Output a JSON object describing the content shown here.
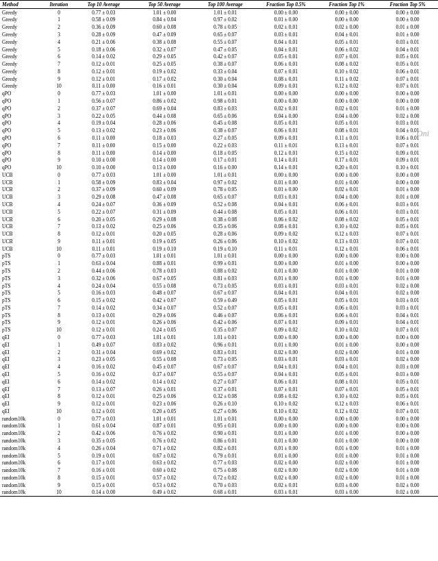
{
  "headers": [
    "Method",
    "Iteration",
    "Top 10 Average",
    "Top 50 Average",
    "Top 100 Average",
    "Fraction Top 0.5%",
    "Fraction Top 1%",
    "Fraction Top 5%"
  ],
  "rows": [
    [
      "Greedy",
      "0",
      "0.77 ± 0.03",
      "1.01 ± 0.00",
      "1.01 ± 0.01",
      "0.00 ± 0.00",
      "0.00 ± 0.00",
      "0.00 ± 0.00"
    ],
    [
      "Greedy",
      "1",
      "0.58 ± 0.09",
      "0.84 ± 0.04",
      "0.97 ± 0.02",
      "0.01 ± 0.00",
      "0.00 ± 0.00",
      "0.00 ± 0.00"
    ],
    [
      "Greedy",
      "2",
      "0.36 ± 0.09",
      "0.60 ± 0.08",
      "0.78 ± 0.05",
      "0.02 ± 0.01",
      "0.02 ± 0.00",
      "0.01 ± 0.00"
    ],
    [
      "Greedy",
      "3",
      "0.28 ± 0.09",
      "0.47 ± 0.09",
      "0.65 ± 0.07",
      "0.03 ± 0.01",
      "0.04 ± 0.01",
      "0.01 ± 0.00"
    ],
    [
      "Greedy",
      "4",
      "0.21 ± 0.06",
      "0.38 ± 0.08",
      "0.55 ± 0.07",
      "0.04 ± 0.01",
      "0.05 ± 0.01",
      "0.03 ± 0.01"
    ],
    [
      "Greedy",
      "5",
      "0.18 ± 0.06",
      "0.32 ± 0.07",
      "0.47 ± 0.05",
      "0.04 ± 0.01",
      "0.06 ± 0.02",
      "0.04 ± 0.01"
    ],
    [
      "Greedy",
      "6",
      "0.14 ± 0.02",
      "0.29 ± 0.05",
      "0.42 ± 0.07",
      "0.05 ± 0.01",
      "0.07 ± 0.01",
      "0.05 ± 0.01"
    ],
    [
      "Greedy",
      "7",
      "0.12 ± 0.01",
      "0.25 ± 0.05",
      "0.38 ± 0.07",
      "0.06 ± 0.01",
      "0.08 ± 0.02",
      "0.05 ± 0.01"
    ],
    [
      "Greedy",
      "8",
      "0.12 ± 0.01",
      "0.19 ± 0.02",
      "0.33 ± 0.04",
      "0.07 ± 0.01",
      "0.10 ± 0.02",
      "0.06 ± 0.01"
    ],
    [
      "Greedy",
      "9",
      "0.12 ± 0.01",
      "0.17 ± 0.02",
      "0.30 ± 0.04",
      "0.08 ± 0.01",
      "0.11 ± 0.02",
      "0.07 ± 0.01"
    ],
    [
      "Greedy",
      "10",
      "0.11 ± 0.00",
      "0.16 ± 0.01",
      "0.30 ± 0.04",
      "0.09 ± 0.01",
      "0.12 ± 0.02",
      "0.07 ± 0.01"
    ],
    [
      "qPO",
      "0",
      "0.77 ± 0.03",
      "1.01 ± 0.00",
      "1.01 ± 0.01",
      "0.00 ± 0.00",
      "0.00 ± 0.00",
      "0.00 ± 0.00"
    ],
    [
      "qPO",
      "1",
      "0.56 ± 0.07",
      "0.86 ± 0.02",
      "0.98 ± 0.01",
      "0.00 ± 0.00",
      "0.00 ± 0.00",
      "0.00 ± 0.00"
    ],
    [
      "qPO",
      "2",
      "0.37 ± 0.07",
      "0.69 ± 0.04",
      "0.83 ± 0.03",
      "0.02 ± 0.01",
      "0.02 ± 0.01",
      "0.01 ± 0.00"
    ],
    [
      "qPO",
      "3",
      "0.22 ± 0.05",
      "0.44 ± 0.08",
      "0.65 ± 0.06",
      "0.04 ± 0.00",
      "0.04 ± 0.00",
      "0.02 ± 0.00"
    ],
    [
      "qPO",
      "4",
      "0.19 ± 0.04",
      "0.28 ± 0.06",
      "0.45 ± 0.08",
      "0.05 ± 0.01",
      "0.05 ± 0.01",
      "0.03 ± 0.01"
    ],
    [
      "qPO",
      "5",
      "0.13 ± 0.02",
      "0.23 ± 0.06",
      "0.38 ± 0.07",
      "0.06 ± 0.01",
      "0.08 ± 0.01",
      "0.04 ± 0.01"
    ],
    [
      "qPO",
      "6",
      "0.11 ± 0.00",
      "0.18 ± 0.03",
      "0.27 ± 0.05",
      "0.09 ± 0.01",
      "0.11 ± 0.01",
      "0.06 ± 0.01"
    ],
    [
      "qPO",
      "7",
      "0.11 ± 0.00",
      "0.15 ± 0.00",
      "0.22 ± 0.03",
      "0.11 ± 0.01",
      "0.13 ± 0.01",
      "0.07 ± 0.01"
    ],
    [
      "qPO",
      "8",
      "0.11 ± 0.00",
      "0.14 ± 0.00",
      "0.18 ± 0.05",
      "0.12 ± 0.01",
      "0.15 ± 0.02",
      "0.09 ± 0.01"
    ],
    [
      "qPO",
      "9",
      "0.10 ± 0.00",
      "0.14 ± 0.00",
      "0.17 ± 0.01",
      "0.14 ± 0.01",
      "0.17 ± 0.01",
      "0.09 ± 0.01"
    ],
    [
      "qPO",
      "10",
      "0.10 ± 0.00",
      "0.13 ± 0.00",
      "0.16 ± 0.00",
      "0.14 ± 0.01",
      "0.20 ± 0.01",
      "0.10 ± 0.01"
    ],
    [
      "UCB",
      "0",
      "0.77 ± 0.03",
      "1.01 ± 0.00",
      "1.01 ± 0.01",
      "0.00 ± 0.00",
      "0.00 ± 0.00",
      "0.00 ± 0.00"
    ],
    [
      "UCB",
      "1",
      "0.58 ± 0.09",
      "0.83 ± 0.04",
      "0.97 ± 0.02",
      "0.01 ± 0.00",
      "0.01 ± 0.00",
      "0.00 ± 0.00"
    ],
    [
      "UCB",
      "2",
      "0.37 ± 0.09",
      "0.60 ± 0.09",
      "0.78 ± 0.05",
      "0.01 ± 0.00",
      "0.02 ± 0.01",
      "0.01 ± 0.00"
    ],
    [
      "UCB",
      "3",
      "0.29 ± 0.08",
      "0.47 ± 0.08",
      "0.65 ± 0.07",
      "0.03 ± 0.01",
      "0.04 ± 0.00",
      "0.01 ± 0.00"
    ],
    [
      "UCB",
      "4",
      "0.24 ± 0.07",
      "0.36 ± 0.09",
      "0.52 ± 0.08",
      "0.04 ± 0.01",
      "0.06 ± 0.01",
      "0.03 ± 0.01"
    ],
    [
      "UCB",
      "5",
      "0.22 ± 0.07",
      "0.31 ± 0.09",
      "0.44 ± 0.08",
      "0.05 ± 0.01",
      "0.06 ± 0.01",
      "0.03 ± 0.01"
    ],
    [
      "UCB",
      "6",
      "0.20 ± 0.05",
      "0.29 ± 0.08",
      "0.38 ± 0.08",
      "0.06 ± 0.02",
      "0.08 ± 0.02",
      "0.05 ± 0.01"
    ],
    [
      "UCB",
      "7",
      "0.13 ± 0.02",
      "0.25 ± 0.06",
      "0.35 ± 0.06",
      "0.08 ± 0.01",
      "0.10 ± 0.02",
      "0.05 ± 0.01"
    ],
    [
      "UCB",
      "8",
      "0.12 ± 0.01",
      "0.20 ± 0.05",
      "0.28 ± 0.06",
      "0.09 ± 0.02",
      "0.12 ± 0.03",
      "0.07 ± 0.01"
    ],
    [
      "UCB",
      "9",
      "0.11 ± 0.01",
      "0.19 ± 0.05",
      "0.26 ± 0.06",
      "0.10 ± 0.02",
      "0.13 ± 0.03",
      "0.07 ± 0.01"
    ],
    [
      "UCB",
      "10",
      "0.11 ± 0.01",
      "0.19 ± 0.10",
      "0.19 ± 0.10",
      "0.11 ± 0.01",
      "0.12 ± 0.01",
      "0.06 ± 0.01"
    ],
    [
      "pTS",
      "0",
      "0.77 ± 0.03",
      "1.01 ± 0.01",
      "1.01 ± 0.01",
      "0.00 ± 0.00",
      "0.00 ± 0.00",
      "0.00 ± 0.00"
    ],
    [
      "pTS",
      "1",
      "0.63 ± 0.04",
      "0.88 ± 0.01",
      "0.99 ± 0.01",
      "0.00 ± 0.00",
      "0.01 ± 0.00",
      "0.00 ± 0.00"
    ],
    [
      "pTS",
      "2",
      "0.44 ± 0.06",
      "0.78 ± 0.03",
      "0.88 ± 0.02",
      "0.01 ± 0.00",
      "0.01 ± 0.00",
      "0.01 ± 0.00"
    ],
    [
      "pTS",
      "3",
      "0.32 ± 0.06",
      "0.67 ± 0.05",
      "0.81 ± 0.03",
      "0.01 ± 0.00",
      "0.01 ± 0.00",
      "0.01 ± 0.00"
    ],
    [
      "pTS",
      "4",
      "0.24 ± 0.04",
      "0.55 ± 0.08",
      "0.73 ± 0.05",
      "0.03 ± 0.01",
      "0.03 ± 0.01",
      "0.02 ± 0.00"
    ],
    [
      "pTS",
      "5",
      "0.16 ± 0.03",
      "0.48 ± 0.07",
      "0.67 ± 0.07",
      "0.04 ± 0.01",
      "0.04 ± 0.01",
      "0.02 ± 0.00"
    ],
    [
      "pTS",
      "6",
      "0.15 ± 0.02",
      "0.42 ± 0.07",
      "0.59 ± 0.49",
      "0.05 ± 0.01",
      "0.05 ± 0.01",
      "0.03 ± 0.01"
    ],
    [
      "pTS",
      "7",
      "0.14 ± 0.02",
      "0.34 ± 0.07",
      "0.52 ± 0.07",
      "0.05 ± 0.01",
      "0.06 ± 0.01",
      "0.03 ± 0.01"
    ],
    [
      "pTS",
      "8",
      "0.13 ± 0.01",
      "0.29 ± 0.06",
      "0.46 ± 0.07",
      "0.06 ± 0.01",
      "0.06 ± 0.01",
      "0.04 ± 0.01"
    ],
    [
      "pTS",
      "9",
      "0.12 ± 0.01",
      "0.26 ± 0.06",
      "0.42 ± 0.06",
      "0.07 ± 0.01",
      "0.09 ± 0.01",
      "0.04 ± 0.01"
    ],
    [
      "pTS",
      "10",
      "0.12 ± 0.01",
      "0.24 ± 0.05",
      "0.35 ± 0.07",
      "0.09 ± 0.02",
      "0.10 ± 0.02",
      "0.07 ± 0.01"
    ],
    [
      "qEI",
      "0",
      "0.77 ± 0.03",
      "1.01 ± 0.01",
      "1.01 ± 0.01",
      "0.00 ± 0.00",
      "0.00 ± 0.00",
      "0.00 ± 0.00"
    ],
    [
      "qEI",
      "1",
      "0.49 ± 0.07",
      "0.83 ± 0.02",
      "0.96 ± 0.01",
      "0.01 ± 0.00",
      "0.01 ± 0.00",
      "0.00 ± 0.00"
    ],
    [
      "qEI",
      "2",
      "0.31 ± 0.04",
      "0.69 ± 0.02",
      "0.83 ± 0.01",
      "0.02 ± 0.00",
      "0.02 ± 0.00",
      "0.01 ± 0.00"
    ],
    [
      "qEI",
      "3",
      "0.23 ± 0.05",
      "0.55 ± 0.08",
      "0.73 ± 0.05",
      "0.03 ± 0.01",
      "0.03 ± 0.01",
      "0.02 ± 0.00"
    ],
    [
      "qEI",
      "4",
      "0.16 ± 0.02",
      "0.45 ± 0.07",
      "0.67 ± 0.07",
      "0.04 ± 0.01",
      "0.04 ± 0.01",
      "0.03 ± 0.00"
    ],
    [
      "qEI",
      "5",
      "0.16 ± 0.02",
      "0.37 ± 0.07",
      "0.55 ± 0.07",
      "0.04 ± 0.01",
      "0.05 ± 0.01",
      "0.03 ± 0.00"
    ],
    [
      "qEI",
      "6",
      "0.14 ± 0.02",
      "0.14 ± 0.02",
      "0.27 ± 0.07",
      "0.06 ± 0.01",
      "0.08 ± 0.01",
      "0.05 ± 0.01"
    ],
    [
      "qEI",
      "7",
      "0.13 ± 0.07",
      "0.26 ± 0.01",
      "0.37 ± 0.01",
      "0.07 ± 0.01",
      "0.07 ± 0.01",
      "0.05 ± 0.01"
    ],
    [
      "qEI",
      "8",
      "0.12 ± 0.01",
      "0.25 ± 0.06",
      "0.32 ± 0.08",
      "0.08 ± 0.02",
      "0.10 ± 0.02",
      "0.05 ± 0.01"
    ],
    [
      "qEI",
      "9",
      "0.12 ± 0.01",
      "0.23 ± 0.06",
      "0.26 ± 0.10",
      "0.10 ± 0.02",
      "0.12 ± 0.03",
      "0.06 ± 0.01"
    ],
    [
      "qEI",
      "10",
      "0.12 ± 0.01",
      "0.20 ± 0.05",
      "0.27 ± 0.06",
      "0.10 ± 0.02",
      "0.12 ± 0.02",
      "0.07 ± 0.01"
    ],
    [
      "random10k",
      "0",
      "0.77 ± 0.03",
      "1.01 ± 0.01",
      "1.01 ± 0.01",
      "0.00 ± 0.00",
      "0.00 ± 0.00",
      "0.00 ± 0.00"
    ],
    [
      "random10k",
      "1",
      "0.61 ± 0.04",
      "0.87 ± 0.01",
      "0.95 ± 0.01",
      "0.00 ± 0.00",
      "0.00 ± 0.00",
      "0.00 ± 0.00"
    ],
    [
      "random10k",
      "2",
      "0.42 ± 0.06",
      "0.76 ± 0.02",
      "0.90 ± 0.01",
      "0.01 ± 0.00",
      "0.01 ± 0.00",
      "0.00 ± 0.00"
    ],
    [
      "random10k",
      "3",
      "0.35 ± 0.05",
      "0.76 ± 0.02",
      "0.86 ± 0.01",
      "0.01 ± 0.00",
      "0.01 ± 0.00",
      "0.00 ± 0.00"
    ],
    [
      "random10k",
      "4",
      "0.26 ± 0.04",
      "0.71 ± 0.02",
      "0.82 ± 0.01",
      "0.01 ± 0.00",
      "0.01 ± 0.00",
      "0.01 ± 0.00"
    ],
    [
      "random10k",
      "5",
      "0.19 ± 0.01",
      "0.67 ± 0.02",
      "0.79 ± 0.01",
      "0.01 ± 0.00",
      "0.01 ± 0.00",
      "0.01 ± 0.00"
    ],
    [
      "random10k",
      "6",
      "0.17 ± 0.01",
      "0.63 ± 0.02",
      "0.77 ± 0.03",
      "0.02 ± 0.00",
      "0.02 ± 0.00",
      "0.01 ± 0.00"
    ],
    [
      "random10k",
      "7",
      "0.16 ± 0.01",
      "0.60 ± 0.02",
      "0.75 ± 0.08",
      "0.02 ± 0.00",
      "0.02 ± 0.00",
      "0.01 ± 0.00"
    ],
    [
      "random10k",
      "8",
      "0.15 ± 0.01",
      "0.57 ± 0.02",
      "0.72 ± 0.02",
      "0.02 ± 0.00",
      "0.02 ± 0.00",
      "0.01 ± 0.00"
    ],
    [
      "random10k",
      "9",
      "0.15 ± 0.01",
      "0.53 ± 0.02",
      "0.70 ± 0.03",
      "0.02 ± 0.01",
      "0.03 ± 0.00",
      "0.02 ± 0.00"
    ],
    [
      "random10k",
      "10",
      "0.14 ± 0.00",
      "0.49 ± 0.02",
      "0.68 ± 0.01",
      "0.03 ± 0.01",
      "0.03 ± 0.00",
      "0.02 ± 0.00"
    ]
  ],
  "watermark": "Oni"
}
